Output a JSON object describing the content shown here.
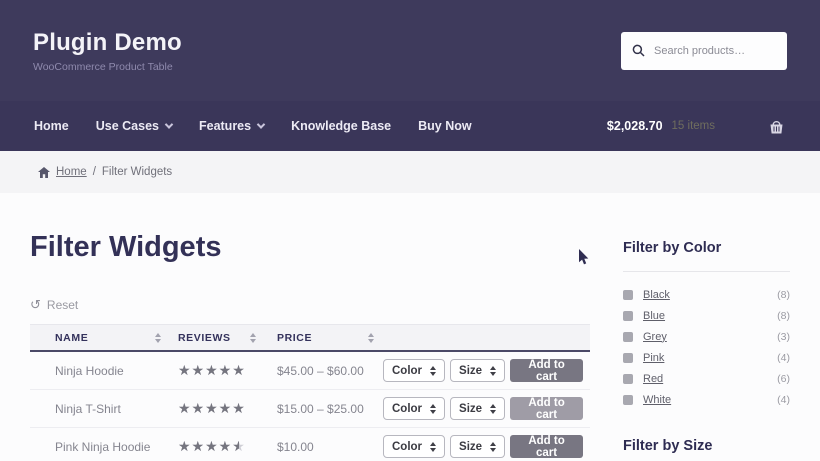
{
  "header": {
    "site_title": "Plugin Demo",
    "site_subtitle": "WooCommerce Product Table",
    "search": {
      "placeholder": "Search products…"
    }
  },
  "nav": {
    "home": "Home",
    "use_cases": "Use Cases",
    "features": "Features",
    "knowledge_base": "Knowledge Base",
    "buy_now": "Buy Now",
    "cart": {
      "total": "$2,028.70",
      "count": "15 items"
    }
  },
  "breadcrumb": {
    "home": "Home",
    "separator": "/",
    "current": "Filter Widgets"
  },
  "page": {
    "title": "Filter Widgets",
    "reset": "Reset",
    "reset_icon": "↺"
  },
  "table": {
    "columns": [
      "NAME",
      "REVIEWS",
      "PRICE"
    ],
    "labels": {
      "color": "Color",
      "size": "Size",
      "add_to_cart": "Add to cart"
    },
    "rows": [
      {
        "name": "Ninja Hoodie",
        "rating": 5,
        "price": "$45.00 – $60.00"
      },
      {
        "name": "Ninja T-Shirt",
        "rating": 5,
        "price": "$15.00 – $25.00"
      },
      {
        "name": "Pink Ninja Hoodie",
        "rating": 4.5,
        "price": "$10.00"
      }
    ]
  },
  "sidebar": {
    "filter_by_color": {
      "title": "Filter by Color",
      "items": [
        {
          "label": "Black",
          "count": "(8)"
        },
        {
          "label": "Blue",
          "count": "(8)"
        },
        {
          "label": "Grey",
          "count": "(3)"
        },
        {
          "label": "Pink",
          "count": "(4)"
        },
        {
          "label": "Red",
          "count": "(6)"
        },
        {
          "label": "White",
          "count": "(4)"
        }
      ]
    },
    "filter_by_size": {
      "title": "Filter by Size"
    }
  },
  "colors": {
    "header_bg": "#3e3a5c",
    "nav_bg": "#3a3659",
    "breadcrumb_bg": "#f4f4f6",
    "heading_text": "#333157",
    "button_bg": "#787682",
    "star_fill": "#75757f"
  }
}
